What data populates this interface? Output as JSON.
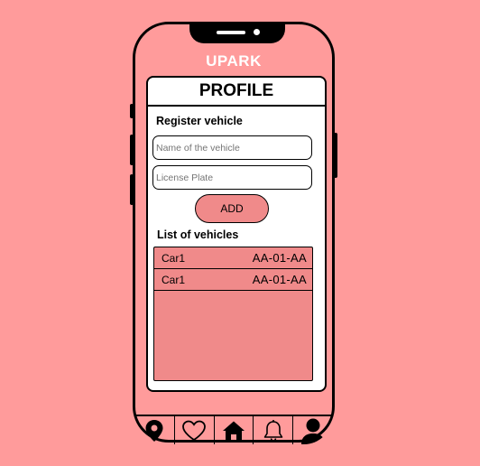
{
  "app": {
    "title": "UPARK"
  },
  "profile": {
    "title": "PROFILE",
    "register_label": "Register vehicle",
    "vehicle_name_placeholder": "Name of the vehicle",
    "license_plate_placeholder": "License Plate",
    "add_label": "ADD",
    "list_label": "List of vehicles",
    "vehicles": [
      {
        "name": "Car1",
        "plate": "AA-01-AA"
      },
      {
        "name": "Car1",
        "plate": "AA-01-AA"
      }
    ]
  },
  "nav": {
    "items": [
      "location-pin-icon",
      "heart-icon",
      "home-icon",
      "bell-icon",
      "user-icon"
    ]
  },
  "colors": {
    "background": "#FF9B9B",
    "accent": "#F08A8A",
    "title_text": "#FFFFFF"
  }
}
